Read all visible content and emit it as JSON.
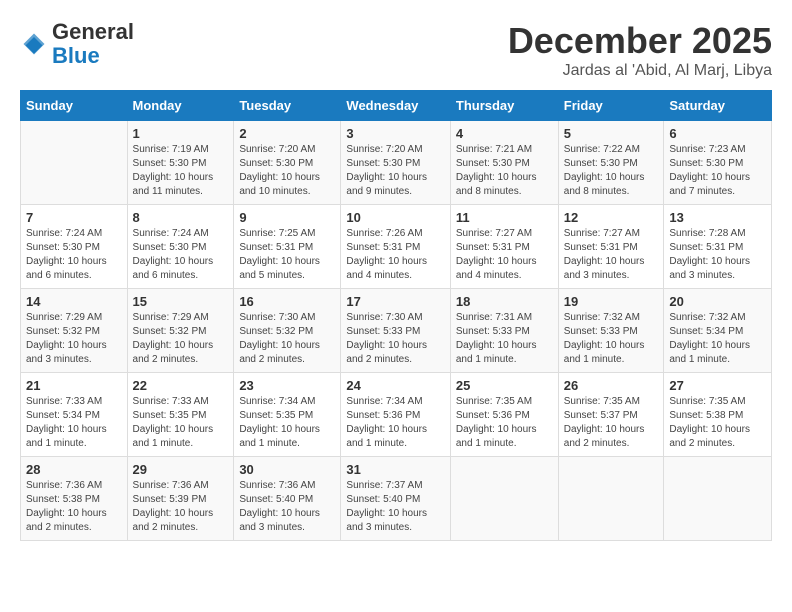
{
  "header": {
    "logo_general": "General",
    "logo_blue": "Blue",
    "month_title": "December 2025",
    "location": "Jardas al 'Abid, Al Marj, Libya"
  },
  "days_of_week": [
    "Sunday",
    "Monday",
    "Tuesday",
    "Wednesday",
    "Thursday",
    "Friday",
    "Saturday"
  ],
  "weeks": [
    [
      {
        "day": "",
        "info": ""
      },
      {
        "day": "1",
        "info": "Sunrise: 7:19 AM\nSunset: 5:30 PM\nDaylight: 10 hours and 11 minutes."
      },
      {
        "day": "2",
        "info": "Sunrise: 7:20 AM\nSunset: 5:30 PM\nDaylight: 10 hours and 10 minutes."
      },
      {
        "day": "3",
        "info": "Sunrise: 7:20 AM\nSunset: 5:30 PM\nDaylight: 10 hours and 9 minutes."
      },
      {
        "day": "4",
        "info": "Sunrise: 7:21 AM\nSunset: 5:30 PM\nDaylight: 10 hours and 8 minutes."
      },
      {
        "day": "5",
        "info": "Sunrise: 7:22 AM\nSunset: 5:30 PM\nDaylight: 10 hours and 8 minutes."
      },
      {
        "day": "6",
        "info": "Sunrise: 7:23 AM\nSunset: 5:30 PM\nDaylight: 10 hours and 7 minutes."
      }
    ],
    [
      {
        "day": "7",
        "info": "Sunrise: 7:24 AM\nSunset: 5:30 PM\nDaylight: 10 hours and 6 minutes."
      },
      {
        "day": "8",
        "info": "Sunrise: 7:24 AM\nSunset: 5:30 PM\nDaylight: 10 hours and 6 minutes."
      },
      {
        "day": "9",
        "info": "Sunrise: 7:25 AM\nSunset: 5:31 PM\nDaylight: 10 hours and 5 minutes."
      },
      {
        "day": "10",
        "info": "Sunrise: 7:26 AM\nSunset: 5:31 PM\nDaylight: 10 hours and 4 minutes."
      },
      {
        "day": "11",
        "info": "Sunrise: 7:27 AM\nSunset: 5:31 PM\nDaylight: 10 hours and 4 minutes."
      },
      {
        "day": "12",
        "info": "Sunrise: 7:27 AM\nSunset: 5:31 PM\nDaylight: 10 hours and 3 minutes."
      },
      {
        "day": "13",
        "info": "Sunrise: 7:28 AM\nSunset: 5:31 PM\nDaylight: 10 hours and 3 minutes."
      }
    ],
    [
      {
        "day": "14",
        "info": "Sunrise: 7:29 AM\nSunset: 5:32 PM\nDaylight: 10 hours and 3 minutes."
      },
      {
        "day": "15",
        "info": "Sunrise: 7:29 AM\nSunset: 5:32 PM\nDaylight: 10 hours and 2 minutes."
      },
      {
        "day": "16",
        "info": "Sunrise: 7:30 AM\nSunset: 5:32 PM\nDaylight: 10 hours and 2 minutes."
      },
      {
        "day": "17",
        "info": "Sunrise: 7:30 AM\nSunset: 5:33 PM\nDaylight: 10 hours and 2 minutes."
      },
      {
        "day": "18",
        "info": "Sunrise: 7:31 AM\nSunset: 5:33 PM\nDaylight: 10 hours and 1 minute."
      },
      {
        "day": "19",
        "info": "Sunrise: 7:32 AM\nSunset: 5:33 PM\nDaylight: 10 hours and 1 minute."
      },
      {
        "day": "20",
        "info": "Sunrise: 7:32 AM\nSunset: 5:34 PM\nDaylight: 10 hours and 1 minute."
      }
    ],
    [
      {
        "day": "21",
        "info": "Sunrise: 7:33 AM\nSunset: 5:34 PM\nDaylight: 10 hours and 1 minute."
      },
      {
        "day": "22",
        "info": "Sunrise: 7:33 AM\nSunset: 5:35 PM\nDaylight: 10 hours and 1 minute."
      },
      {
        "day": "23",
        "info": "Sunrise: 7:34 AM\nSunset: 5:35 PM\nDaylight: 10 hours and 1 minute."
      },
      {
        "day": "24",
        "info": "Sunrise: 7:34 AM\nSunset: 5:36 PM\nDaylight: 10 hours and 1 minute."
      },
      {
        "day": "25",
        "info": "Sunrise: 7:35 AM\nSunset: 5:36 PM\nDaylight: 10 hours and 1 minute."
      },
      {
        "day": "26",
        "info": "Sunrise: 7:35 AM\nSunset: 5:37 PM\nDaylight: 10 hours and 2 minutes."
      },
      {
        "day": "27",
        "info": "Sunrise: 7:35 AM\nSunset: 5:38 PM\nDaylight: 10 hours and 2 minutes."
      }
    ],
    [
      {
        "day": "28",
        "info": "Sunrise: 7:36 AM\nSunset: 5:38 PM\nDaylight: 10 hours and 2 minutes."
      },
      {
        "day": "29",
        "info": "Sunrise: 7:36 AM\nSunset: 5:39 PM\nDaylight: 10 hours and 2 minutes."
      },
      {
        "day": "30",
        "info": "Sunrise: 7:36 AM\nSunset: 5:40 PM\nDaylight: 10 hours and 3 minutes."
      },
      {
        "day": "31",
        "info": "Sunrise: 7:37 AM\nSunset: 5:40 PM\nDaylight: 10 hours and 3 minutes."
      },
      {
        "day": "",
        "info": ""
      },
      {
        "day": "",
        "info": ""
      },
      {
        "day": "",
        "info": ""
      }
    ]
  ]
}
